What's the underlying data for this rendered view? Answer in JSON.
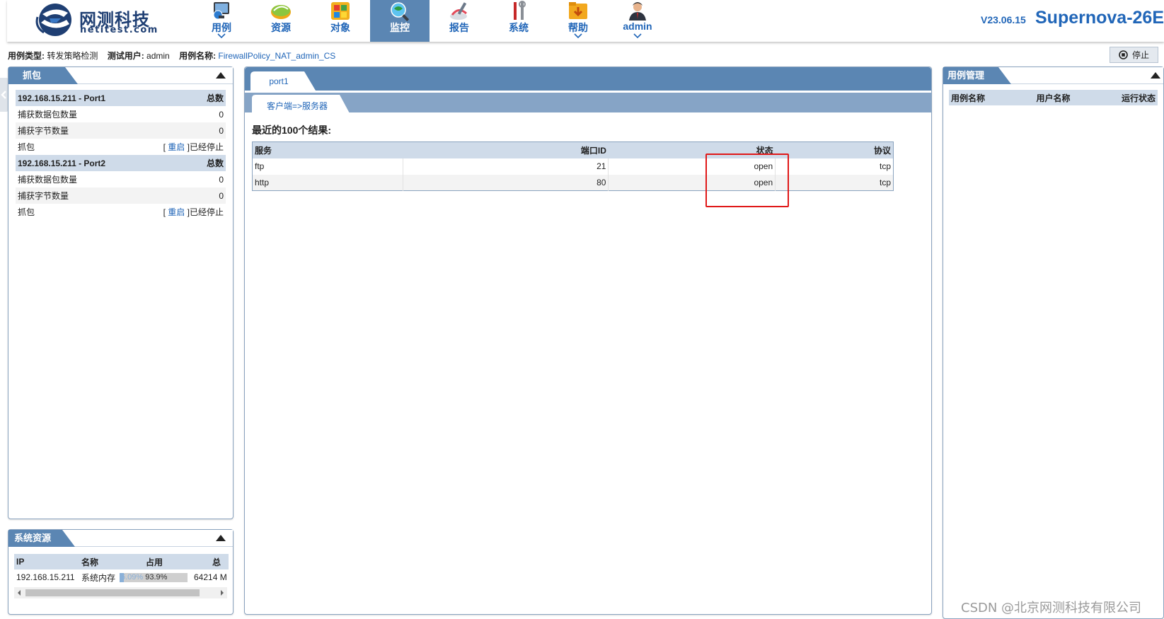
{
  "header": {
    "logo_cn": "网测科技",
    "logo_en": "netitest.com",
    "version": "V23.06.15",
    "product": "Supernova-26E",
    "nav": [
      {
        "label": "用例",
        "icon": "monitor-globe-icon",
        "has_menu": true,
        "active": false
      },
      {
        "label": "资源",
        "icon": "resource-disc-icon",
        "has_menu": false,
        "active": false
      },
      {
        "label": "对象",
        "icon": "objects-grid-icon",
        "has_menu": false,
        "active": false
      },
      {
        "label": "监控",
        "icon": "monitor-magnifier-icon",
        "has_menu": false,
        "active": true
      },
      {
        "label": "报告",
        "icon": "report-pen-icon",
        "has_menu": false,
        "active": false
      },
      {
        "label": "系统",
        "icon": "tools-icon",
        "has_menu": false,
        "active": false
      },
      {
        "label": "帮助",
        "icon": "help-folder-icon",
        "has_menu": true,
        "active": false
      },
      {
        "label": "admin",
        "icon": "user-icon",
        "has_menu": true,
        "active": false
      }
    ]
  },
  "info": {
    "type_key": "用例类型:",
    "type_val": "转发策略检测",
    "user_key": "测试用户:",
    "user_val": "admin",
    "name_key": "用例名称:",
    "name_val": "FirewallPolicy_NAT_admin_CS",
    "stop_label": "停止"
  },
  "capture": {
    "title": "抓包",
    "total_label": "总数",
    "ports": [
      {
        "name": "192.168.15.211 - Port1",
        "packets_label": "捕获数据包数量",
        "packets": "0",
        "bytes_label": "捕获字节数量",
        "bytes": "0",
        "cap_label": "抓包",
        "bracket_open": "[",
        "restart": "重启",
        "bracket_close": "]已经停止"
      },
      {
        "name": "192.168.15.211 - Port2",
        "packets_label": "捕获数据包数量",
        "packets": "0",
        "bytes_label": "捕获字节数量",
        "bytes": "0",
        "cap_label": "抓包",
        "bracket_open": "[",
        "restart": "重启",
        "bracket_close": "]已经停止"
      }
    ]
  },
  "resources": {
    "title": "系统资源",
    "headers": [
      "IP",
      "名称",
      "占用",
      "总"
    ],
    "row": {
      "ip": "192.168.15.211",
      "name": "系统内存",
      "usage_text": "6.09%",
      "usage_pct": 6.09,
      "free_text": "93.9%",
      "total": "64214 M"
    }
  },
  "monitor": {
    "tab": "port1",
    "subtab": "客户端=>服务器",
    "result_title": "最近的100个结果:",
    "headers": [
      "服务",
      "端口ID",
      "状态",
      "协议"
    ],
    "rows": [
      {
        "service": "ftp",
        "port": "21",
        "status": "open",
        "protocol": "tcp"
      },
      {
        "service": "http",
        "port": "80",
        "status": "open",
        "protocol": "tcp"
      }
    ]
  },
  "case_mgmt": {
    "title": "用例管理",
    "headers": [
      "用例名称",
      "用户名称",
      "运行状态"
    ]
  },
  "watermark": "CSDN @北京网测科技有限公司",
  "colors": {
    "accent": "#2166b8",
    "panel_tab": "#5b86b3",
    "header_row": "#cfdbe9",
    "highlight": "#e01818"
  }
}
